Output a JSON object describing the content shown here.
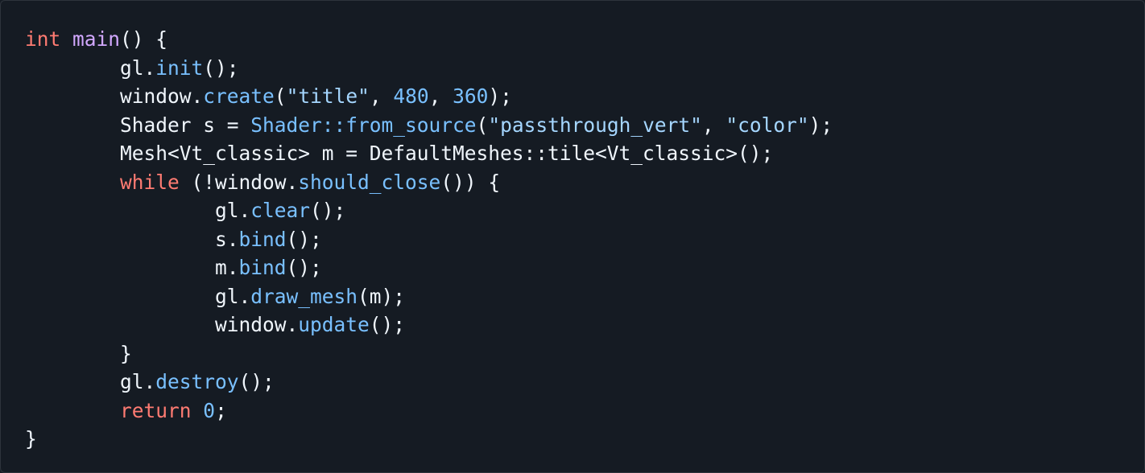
{
  "colors": {
    "background": "#151b23",
    "text": "#f0f6fc",
    "keyword": "#ff7b72",
    "function_name": "#d2a8ff",
    "method_call": "#79c0ff",
    "string": "#a5d6ff",
    "number": "#79c0ff"
  },
  "code": {
    "lines": [
      {
        "indent": "",
        "tokens": [
          {
            "t": "int",
            "c": "kw"
          },
          {
            "t": " ",
            "c": "txt"
          },
          {
            "t": "main",
            "c": "fn"
          },
          {
            "t": "() {",
            "c": "txt"
          }
        ]
      },
      {
        "indent": "\t",
        "tokens": [
          {
            "t": "gl.",
            "c": "txt"
          },
          {
            "t": "init",
            "c": "ent"
          },
          {
            "t": "();",
            "c": "txt"
          }
        ]
      },
      {
        "indent": "\t",
        "tokens": [
          {
            "t": "window.",
            "c": "txt"
          },
          {
            "t": "create",
            "c": "ent"
          },
          {
            "t": "(",
            "c": "txt"
          },
          {
            "t": "\"title\"",
            "c": "str"
          },
          {
            "t": ", ",
            "c": "txt"
          },
          {
            "t": "480",
            "c": "num"
          },
          {
            "t": ", ",
            "c": "txt"
          },
          {
            "t": "360",
            "c": "num"
          },
          {
            "t": ");",
            "c": "txt"
          }
        ]
      },
      {
        "indent": "\t",
        "tokens": [
          {
            "t": "Shader s = ",
            "c": "txt"
          },
          {
            "t": "Shader::from_source",
            "c": "ent"
          },
          {
            "t": "(",
            "c": "txt"
          },
          {
            "t": "\"passthrough_vert\"",
            "c": "str"
          },
          {
            "t": ", ",
            "c": "txt"
          },
          {
            "t": "\"color\"",
            "c": "str"
          },
          {
            "t": ");",
            "c": "txt"
          }
        ]
      },
      {
        "indent": "\t",
        "tokens": [
          {
            "t": "Mesh<Vt_classic> m = DefaultMeshes::tile<Vt_classic>();",
            "c": "txt"
          }
        ]
      },
      {
        "indent": "\t",
        "tokens": [
          {
            "t": "while",
            "c": "kw"
          },
          {
            "t": " (!window.",
            "c": "txt"
          },
          {
            "t": "should_close",
            "c": "ent"
          },
          {
            "t": "()) {",
            "c": "txt"
          }
        ]
      },
      {
        "indent": "\t\t",
        "tokens": [
          {
            "t": "gl.",
            "c": "txt"
          },
          {
            "t": "clear",
            "c": "ent"
          },
          {
            "t": "();",
            "c": "txt"
          }
        ]
      },
      {
        "indent": "\t\t",
        "tokens": [
          {
            "t": "s.",
            "c": "txt"
          },
          {
            "t": "bind",
            "c": "ent"
          },
          {
            "t": "();",
            "c": "txt"
          }
        ]
      },
      {
        "indent": "\t\t",
        "tokens": [
          {
            "t": "m.",
            "c": "txt"
          },
          {
            "t": "bind",
            "c": "ent"
          },
          {
            "t": "();",
            "c": "txt"
          }
        ]
      },
      {
        "indent": "\t\t",
        "tokens": [
          {
            "t": "gl.",
            "c": "txt"
          },
          {
            "t": "draw_mesh",
            "c": "ent"
          },
          {
            "t": "(m);",
            "c": "txt"
          }
        ]
      },
      {
        "indent": "\t\t",
        "tokens": [
          {
            "t": "window.",
            "c": "txt"
          },
          {
            "t": "update",
            "c": "ent"
          },
          {
            "t": "();",
            "c": "txt"
          }
        ]
      },
      {
        "indent": "\t",
        "tokens": [
          {
            "t": "}",
            "c": "txt"
          }
        ]
      },
      {
        "indent": "\t",
        "tokens": [
          {
            "t": "gl.",
            "c": "txt"
          },
          {
            "t": "destroy",
            "c": "ent"
          },
          {
            "t": "();",
            "c": "txt"
          }
        ]
      },
      {
        "indent": "\t",
        "tokens": [
          {
            "t": "return",
            "c": "kw"
          },
          {
            "t": " ",
            "c": "txt"
          },
          {
            "t": "0",
            "c": "num"
          },
          {
            "t": ";",
            "c": "txt"
          }
        ]
      },
      {
        "indent": "",
        "tokens": [
          {
            "t": "}",
            "c": "txt"
          }
        ]
      }
    ]
  }
}
